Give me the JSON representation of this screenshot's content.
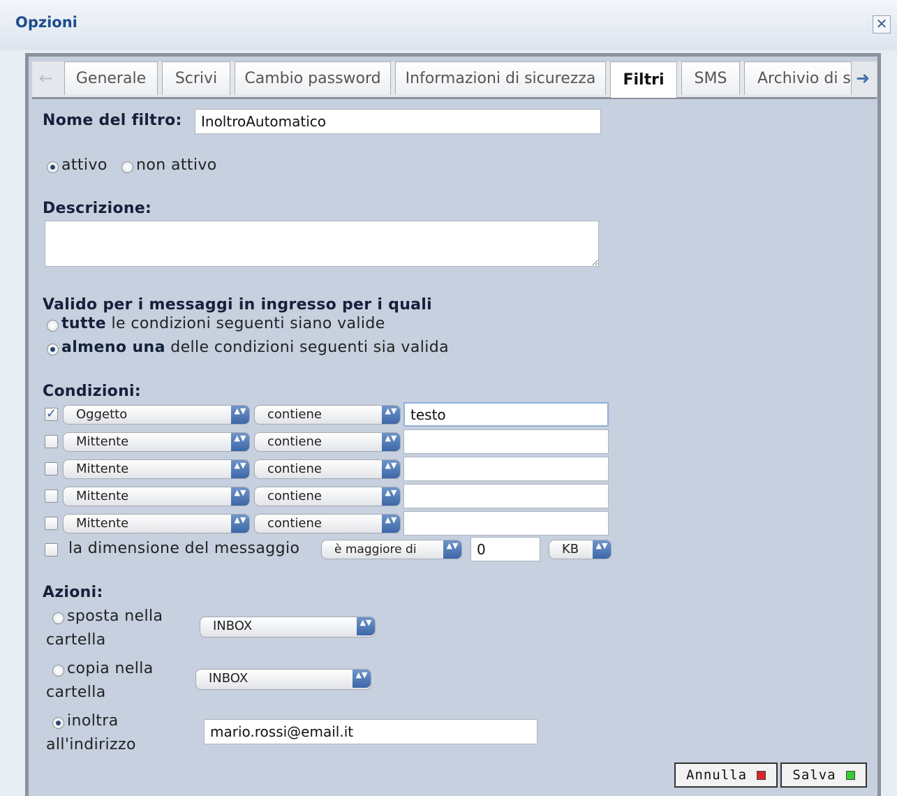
{
  "dialog": {
    "title": "Opzioni",
    "close_glyph": "✕"
  },
  "tabs": {
    "prev_glyph": "←",
    "next_glyph": "➜",
    "items": [
      {
        "label": "Generale"
      },
      {
        "label": "Scrivi"
      },
      {
        "label": "Cambio password"
      },
      {
        "label": "Informazioni di sicurezza"
      },
      {
        "label": "Filtri",
        "active": true
      },
      {
        "label": "SMS"
      },
      {
        "label": "Archivio di si"
      }
    ]
  },
  "form": {
    "name_label": "Nome del filtro:",
    "name_value": "InoltroAutomatico",
    "status": {
      "active_label": "attivo",
      "inactive_label": "non attivo",
      "selected": "attivo"
    },
    "description_label": "Descrizione:",
    "description_value": "",
    "valid_title": "Valido per i messaggi in ingresso per i quali",
    "match_all": {
      "bold": "tutte",
      "rest": " le condizioni seguenti siano valide"
    },
    "match_any": {
      "bold": "almeno una",
      "rest": " delle condizioni seguenti sia valida"
    },
    "match_selected": "almeno una",
    "conditions_label": "Condizioni:",
    "conditions": [
      {
        "checked": true,
        "field": "Oggetto",
        "operator": "contiene",
        "value": "testo"
      },
      {
        "checked": false,
        "field": "Mittente",
        "operator": "contiene",
        "value": ""
      },
      {
        "checked": false,
        "field": "Mittente",
        "operator": "contiene",
        "value": ""
      },
      {
        "checked": false,
        "field": "Mittente",
        "operator": "contiene",
        "value": ""
      },
      {
        "checked": false,
        "field": "Mittente",
        "operator": "contiene",
        "value": ""
      }
    ],
    "size_condition": {
      "label": "la dimensione del messaggio",
      "operator": "è maggiore di",
      "value": "0",
      "unit": "KB"
    },
    "actions_label": "Azioni:",
    "actions": {
      "move": {
        "line1": "sposta nella",
        "line2": "cartella",
        "folder": "INBOX"
      },
      "copy": {
        "line1": "copia nella",
        "line2": "cartella",
        "folder": "INBOX"
      },
      "forward": {
        "line1": "inoltra",
        "line2": "all'indirizzo",
        "address": "mario.rossi@email.it"
      },
      "selected": "inoltra"
    },
    "buttons": {
      "cancel": "Annulla",
      "save": "Salva"
    },
    "colors": {
      "cancel_indicator": "#d9252a",
      "save_indicator": "#33cc33",
      "title": "#1d4c8c"
    },
    "stepper_glyph": "▲▼",
    "check_glyph": "✓"
  }
}
